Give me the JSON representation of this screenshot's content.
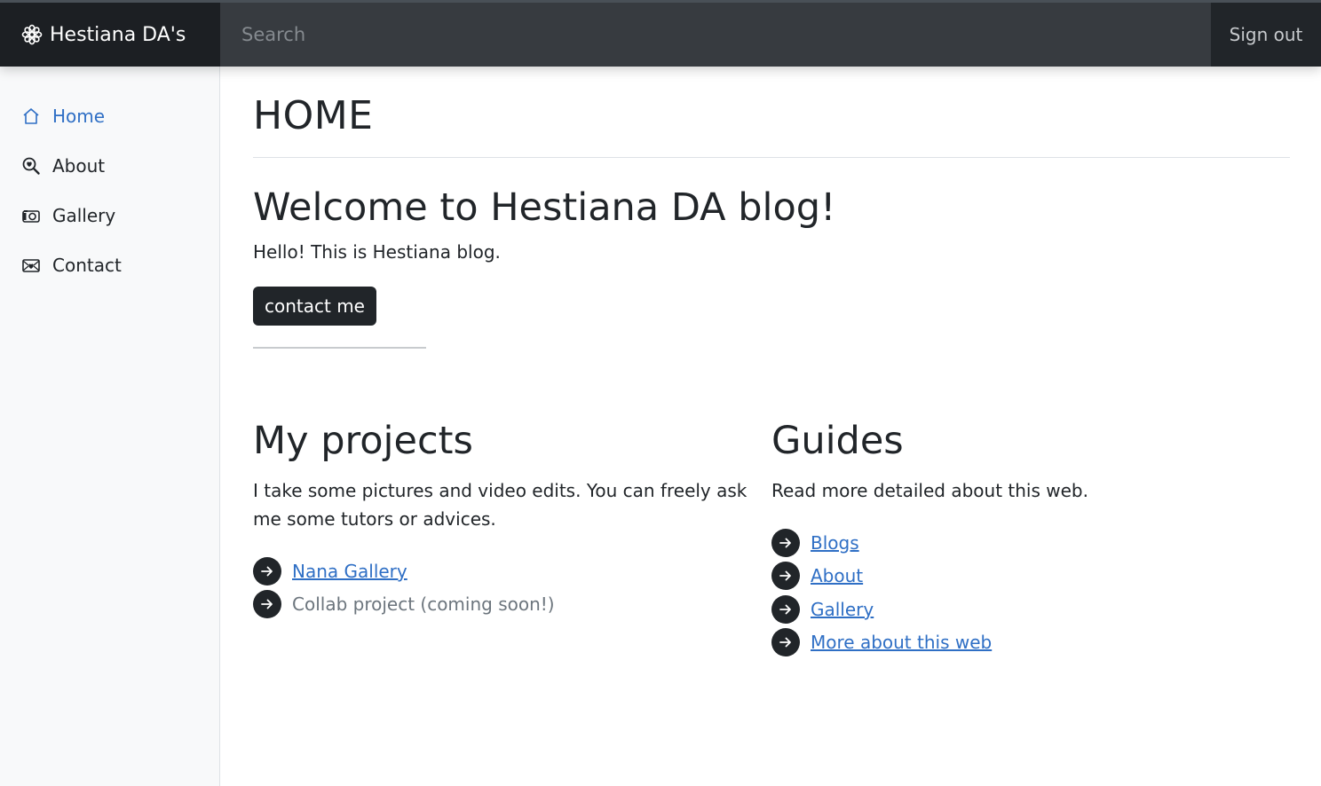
{
  "header": {
    "brand": "Hestiana DA's",
    "brand_icon": "flower-icon",
    "search_placeholder": "Search",
    "signout_label": "Sign out"
  },
  "sidebar": {
    "items": [
      {
        "label": "Home",
        "icon": "house-icon",
        "active": true
      },
      {
        "label": "About",
        "icon": "search-heart-icon",
        "active": false
      },
      {
        "label": "Gallery",
        "icon": "camera-icon",
        "active": false
      },
      {
        "label": "Contact",
        "icon": "envelope-heart-icon",
        "active": false
      }
    ]
  },
  "main": {
    "page_title": "HOME",
    "welcome_title": "Welcome to Hestiana DA blog!",
    "intro": "Hello! This is Hestiana blog.",
    "contact_button": "contact me",
    "projects": {
      "title": "My projects",
      "text": "I take some pictures and video edits. You can freely ask me some tutors or advices.",
      "items": [
        {
          "label": "Nana Gallery",
          "link": true
        },
        {
          "label": "Collab project (coming soon!)",
          "link": false
        }
      ]
    },
    "guides": {
      "title": "Guides",
      "text": "Read more detailed about this web.",
      "items": [
        {
          "label": "Blogs",
          "link": true
        },
        {
          "label": "About",
          "link": true
        },
        {
          "label": "Gallery",
          "link": true
        },
        {
          "label": "More about this web",
          "link": true
        }
      ]
    }
  },
  "colors": {
    "dark": "#212529",
    "link": "#2f6fc5",
    "sidebar_bg": "#f8f9fa"
  }
}
